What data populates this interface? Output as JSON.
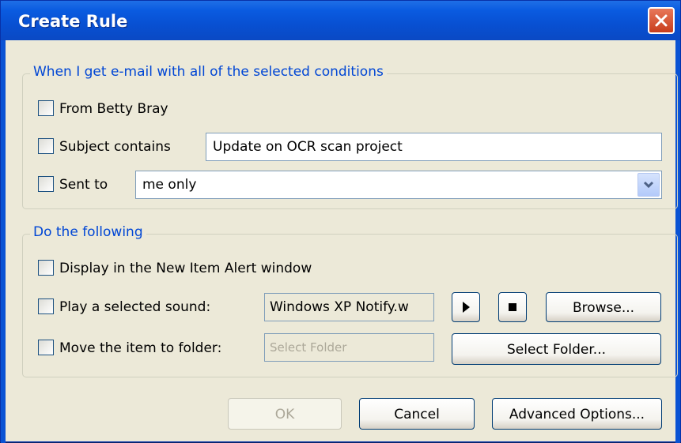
{
  "window": {
    "title": "Create Rule"
  },
  "conditions": {
    "group_title": "When I get e-mail with all of the selected conditions",
    "from_label": "From Betty Bray",
    "subject_label": "Subject contains",
    "subject_value": "Update on OCR scan project",
    "sent_to_label": "Sent to",
    "sent_to_value": "me only"
  },
  "actions": {
    "group_title": "Do the following",
    "alert_label": "Display in the New Item Alert window",
    "sound_label": "Play a selected sound:",
    "sound_value": "Windows XP Notify.w",
    "browse_label": "Browse...",
    "move_label": "Move the item to folder:",
    "folder_placeholder": "Select Folder",
    "select_folder_label": "Select Folder..."
  },
  "footer": {
    "ok_label": "OK",
    "cancel_label": "Cancel",
    "advanced_label": "Advanced Options..."
  },
  "icons": {
    "close": "close-icon",
    "dropdown": "chevron-down-icon",
    "play": "play-icon",
    "stop": "stop-icon"
  },
  "colors": {
    "title_bar": "#0a5be0",
    "group_title": "#0046d5",
    "close_button": "#c83d1c"
  }
}
